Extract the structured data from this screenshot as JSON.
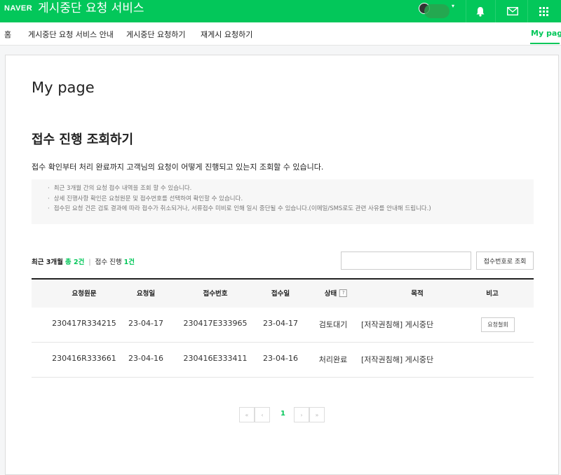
{
  "header": {
    "logo": "NAVER",
    "service_title": "게시중단 요청 서비스",
    "caret": "▾"
  },
  "nav": {
    "items": [
      "홈",
      "게시중단 요청 서비스 안내",
      "게시중단 요청하기",
      "재게시 요청하기"
    ],
    "my_page": "My page"
  },
  "main": {
    "page_title": "My page",
    "section_title": "접수 진행 조회하기",
    "description": "접수 확인부터 처리 완료까지 고객님의 요청이 어떻게 진행되고 있는지 조회할 수 있습니다.",
    "notes": [
      "최근 3개월 간의 요청 접수 내역을 조회 할 수 있습니다.",
      "상세 진행사항 확인은 요청원문 및 접수번호를 선택하여 확인할 수 있습니다.",
      "접수된 요청 건은 검토 결과에 따라 접수가 취소되거나, 서류접수 미비로 인해 일시 중단될 수 있습니다.(이메일/SMS로도 관련 사유를 안내해 드립니다.)"
    ],
    "summary": {
      "period": "최근 3개월",
      "total": "총 2건",
      "separator": "|",
      "in_progress_label": "접수 진행",
      "in_progress": "1건"
    },
    "search": {
      "value": "",
      "placeholder": "",
      "button": "접수번호로 조회"
    },
    "table": {
      "headers": [
        "요청원문",
        "요청일",
        "접수번호",
        "접수일",
        "상태",
        "목적",
        "비고"
      ],
      "help_mark": "?",
      "rows": [
        {
          "original": "230417R334215",
          "request_date": "23-04-17",
          "receipt_no": "230417E333965",
          "receipt_date": "23-04-17",
          "status": "검토대기",
          "purpose": "[저작권침해] 게시중단",
          "action": "요청철회"
        },
        {
          "original": "230416R333661",
          "request_date": "23-04-16",
          "receipt_no": "230416E333411",
          "receipt_date": "23-04-16",
          "status": "처리완료",
          "purpose": "[저작권침해] 게시중단",
          "action": ""
        }
      ]
    },
    "pagination": {
      "first": "«",
      "prev": "‹",
      "current": "1",
      "next": "›",
      "last": "»"
    }
  },
  "colors": {
    "brand": "#03c75a",
    "text": "#333333"
  },
  "icons": [
    "bell-icon",
    "mail-icon",
    "apps-grid-icon"
  ]
}
